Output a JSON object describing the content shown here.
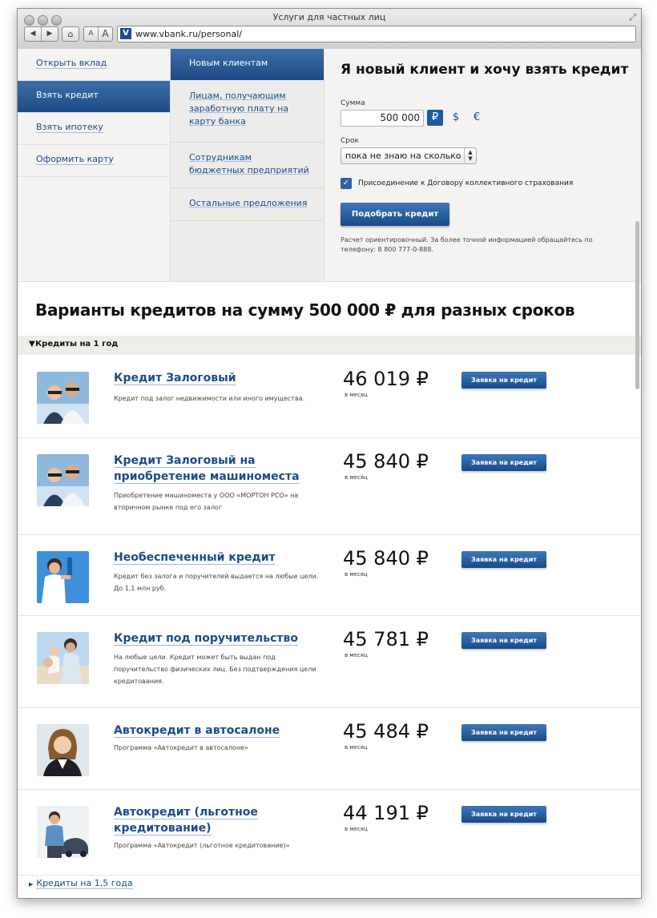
{
  "browser": {
    "window_title": "Услуги для частных лиц",
    "url": "www.vbank.ru/personal/",
    "back_icon": "◀",
    "forward_icon": "▶",
    "home_icon": "⌂",
    "font_smaller": "A",
    "font_larger": "A",
    "favicon": "V",
    "resize_icon": "⤢"
  },
  "menu_primary": {
    "items": [
      {
        "label": "Открыть вклад"
      },
      {
        "label": "Взять кредит",
        "active": true
      },
      {
        "label": "Взять ипотеку"
      },
      {
        "label": "Оформить карту"
      }
    ]
  },
  "menu_secondary": {
    "header": "Новым клиентам",
    "items": [
      {
        "label": "Лицам, получающим заработную плату на карту банка"
      },
      {
        "label": "Сотрудникам бюджетных предприятий"
      },
      {
        "label": "Остальные предложения"
      }
    ]
  },
  "loan_form": {
    "title": "Я новый клиент и хочу взять кредит",
    "sum_label": "Сумма",
    "sum_value": "500 000",
    "currencies": [
      "₽",
      "$",
      "€"
    ],
    "selected_currency": "₽",
    "term_label": "Срок",
    "term_value": "пока не знаю на сколько",
    "insurance_checked": true,
    "insurance_label": "Присоединение к Договору коллективного страхования",
    "check_mark": "✓",
    "submit_label": "Подобрать кредит",
    "note": "Расчет ориентировочный. За более точной информацией обращайтесь по телефону: 8 800 777-0-888."
  },
  "results": {
    "heading": "Варианты кредитов на сумму 500 000 ₽ для разных сроков",
    "group_label": "Кредиты на 1 год",
    "group_toggle_icon": "▼",
    "per_month": "в месяц",
    "apply_label": "Заявка на кредит",
    "loans": [
      {
        "name": "Кредит Залоговый",
        "description": "Кредит под залог недвижимости или иного имущества.",
        "amount": "46 019 ₽",
        "image": "couple-glasses"
      },
      {
        "name": "Кредит Залоговый на приобретение машиноместа",
        "description": "Приобретение машиноместа у ООО «МОРТОН РСО» на вторичном рынке под его залог",
        "amount": "45 840 ₽",
        "image": "couple-glasses"
      },
      {
        "name": "Необеспеченный кредит",
        "description": "Кредит без залога и поручителей выдается на любые цели. До 1,1 млн руб.",
        "amount": "45 840 ₽",
        "image": "man-painting-wall"
      },
      {
        "name": "Кредит под поручительство",
        "description": "На любые цели. Кредит может быть выдан под поручительство физических лиц. Без подтверждения цели кредитования.",
        "amount": "45 781 ₽",
        "image": "family-beach"
      },
      {
        "name": "Автокредит в автосалоне",
        "description": "Программа «Автокредит в автосалоне»",
        "amount": "45 484 ₽",
        "image": "woman-portrait"
      },
      {
        "name": "Автокредит (льготное кредитование)",
        "description": "Программа «Автокредит (льготное кредитование)»",
        "amount": "44 191 ₽",
        "image": "man-with-car"
      }
    ],
    "next_group_label": "Кредиты на 1,5 года",
    "next_group_icon": "▶"
  }
}
